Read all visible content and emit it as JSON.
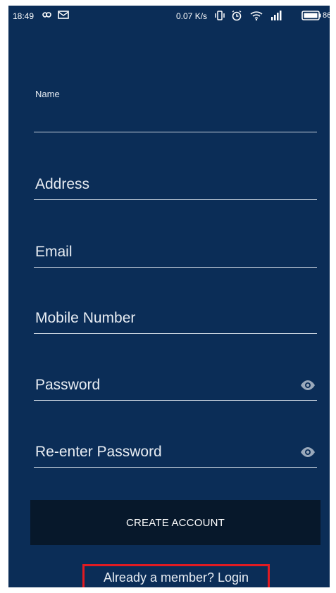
{
  "status_bar": {
    "time": "18:49",
    "speed": "0.07 K/s",
    "battery": "86",
    "icons": [
      "infinity-icon",
      "mail-icon",
      "vibrate-icon",
      "alarm-icon",
      "wifi-icon",
      "signal-icon",
      "battery-icon"
    ]
  },
  "form": {
    "name_label": "Name",
    "address_label": "Address",
    "email_label": "Email",
    "mobile_label": "Mobile Number",
    "password_label": "Password",
    "repassword_label": "Re-enter Password"
  },
  "actions": {
    "create_label": "CREATE ACCOUNT",
    "login_label": "Already a member? Login"
  },
  "colors": {
    "background": "#0b2d57",
    "button": "#07182b",
    "underline": "#c9d3df",
    "highlight": "#e11b22"
  }
}
